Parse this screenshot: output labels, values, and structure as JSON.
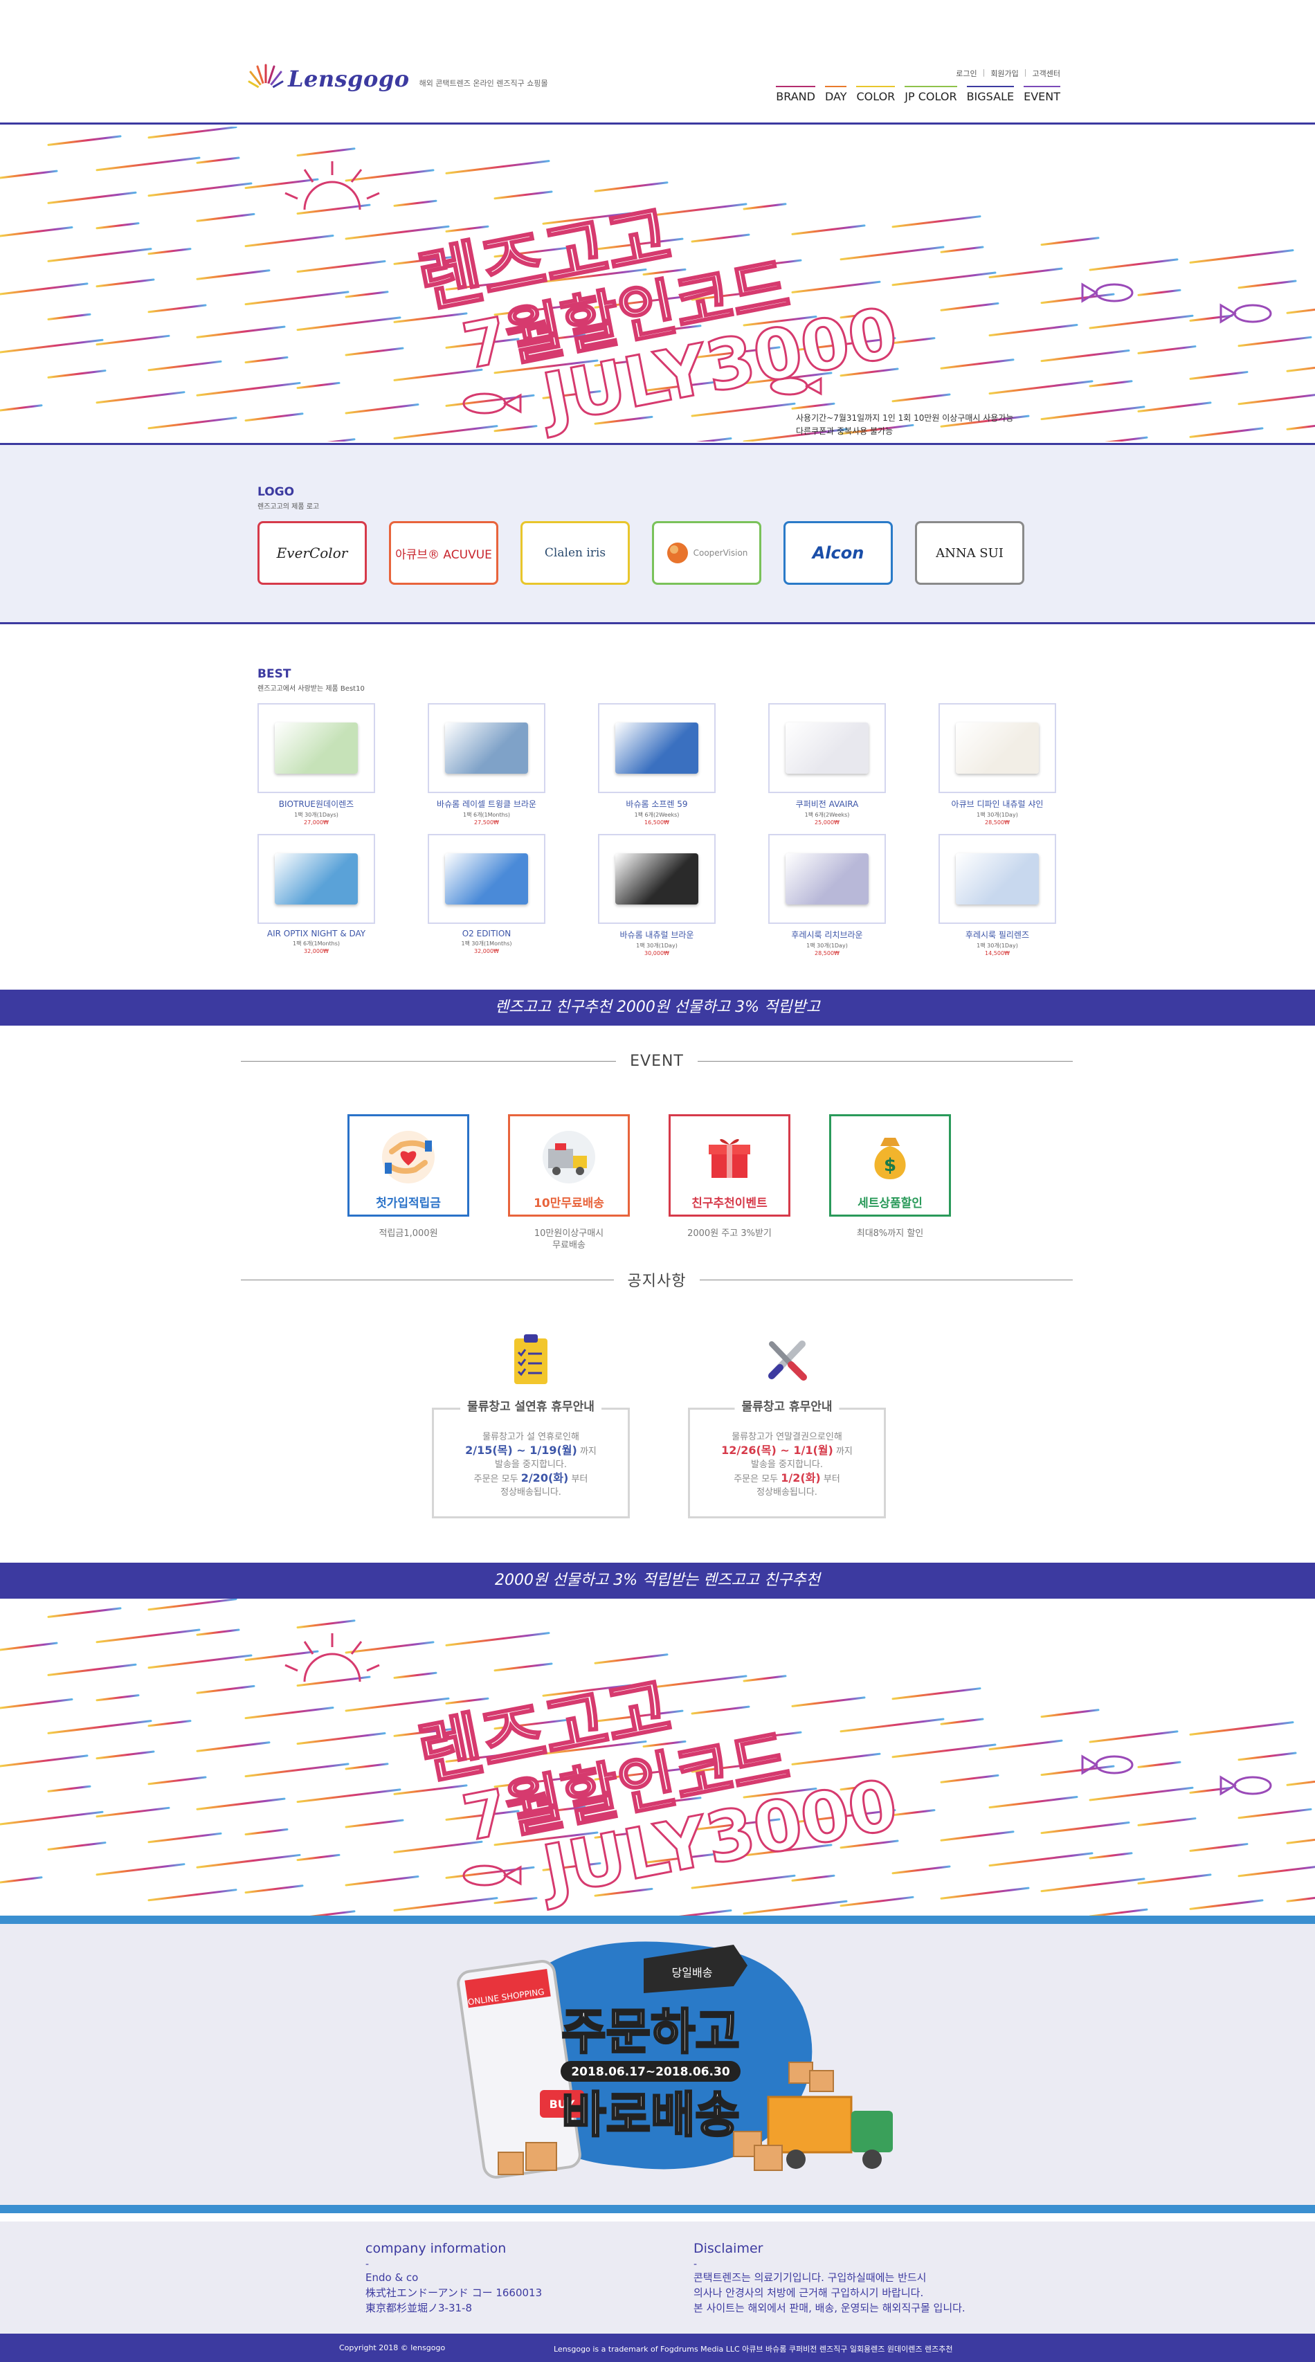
{
  "header": {
    "brand_name": "Lensgogo",
    "tagline": "해외 콘택트렌즈 온라인 렌즈직구 쇼핑몰",
    "util_links": [
      "로그인",
      "회원가입",
      "고객센터"
    ],
    "nav": [
      {
        "label": "BRAND",
        "color": "#b42c6e"
      },
      {
        "label": "DAY",
        "color": "#e87a2c"
      },
      {
        "label": "COLOR",
        "color": "#e8c62c"
      },
      {
        "label": "JP COLOR",
        "color": "#8fc24a"
      },
      {
        "label": "BIGSALE",
        "color": "#3c3aa0"
      },
      {
        "label": "EVENT",
        "color": "#7a4ab8"
      }
    ]
  },
  "banner": {
    "line1": "렌즈고고",
    "line2": "7월할인코드",
    "line3": "JULY3000",
    "note_line1": "사용기간~7월31일까지 1인 1회 10만원 이상구매시 사용가능",
    "note_line2": "다른쿠폰과 중복사용 불가능"
  },
  "logo_section": {
    "title": "LOGO",
    "subtitle": "렌즈고고의 제품 로고",
    "brands": [
      {
        "name": "EverColor",
        "color": "#d63a4a"
      },
      {
        "name": "아큐브® ACUVUE",
        "color": "#e8643c"
      },
      {
        "name": "Clalen iris",
        "color": "#e8c62c"
      },
      {
        "name": "CooperVision",
        "color": "#7ac25a"
      },
      {
        "name": "Alcon",
        "color": "#2a7ac8"
      },
      {
        "name": "ANNA SUI",
        "color": "#8a8a8a"
      }
    ]
  },
  "best": {
    "title": "BEST",
    "subtitle": "렌즈고고에서 사랑받는 제품 Best10",
    "products": [
      {
        "name": "BIOTRUE원데이렌즈",
        "desc": "1팩 30개(1Days)",
        "price": "27,000₩",
        "pack": "#c6e2b8"
      },
      {
        "name": "바슈롬 레이셀 트윙클 브라운",
        "desc": "1팩 6개(1Months)",
        "price": "27,500₩",
        "pack": "#7fa2c8"
      },
      {
        "name": "바슈롬 소프렌 59",
        "desc": "1팩 6개(2Weeks)",
        "price": "16,500₩",
        "pack": "#3a70c0"
      },
      {
        "name": "쿠퍼비전 AVAIRA",
        "desc": "1팩 6개(2Weeks)",
        "price": "25,000₩",
        "pack": "#e8e8ee"
      },
      {
        "name": "아큐브 디파인 내츄럴 샤인",
        "desc": "1팩 30개(1Day)",
        "price": "28,500₩",
        "pack": "#f2eee6"
      },
      {
        "name": "AIR OPTIX NIGHT & DAY",
        "desc": "1팩 6개(1Months)",
        "price": "32,000₩",
        "pack": "#5aa2d8"
      },
      {
        "name": "O2 EDITION",
        "desc": "1팩 30개(1Months)",
        "price": "32,000₩",
        "pack": "#4a8ad8"
      },
      {
        "name": "바슈롬 내츄럴 브라운",
        "desc": "1팩 30개(1Day)",
        "price": "30,000₩",
        "pack": "#2a2a2a"
      },
      {
        "name": "후레시룩 리치브라운",
        "desc": "1팩 30개(1Day)",
        "price": "28,500₩",
        "pack": "#b8b8d8"
      },
      {
        "name": "후레시룩 필리렌즈",
        "desc": "1팩 30개(1Day)",
        "price": "14,500₩",
        "pack": "#c8d8ee"
      }
    ]
  },
  "strip1": "렌즈고고 친구추천 2000원 선물하고 3% 적립받고",
  "event": {
    "title": "EVENT",
    "items": [
      {
        "label": "첫가입적립금",
        "sub": "적립금1,000원",
        "color": "#2a72c8",
        "icon": "heart-hands-icon"
      },
      {
        "label": "10만무료배송",
        "sub": "10만원이상구매시\n무료배송",
        "color": "#e8643c",
        "icon": "delivery-truck-icon"
      },
      {
        "label": "친구추천이벤트",
        "sub": "2000원 주고 3%받기",
        "color": "#d63a4a",
        "icon": "gift-box-icon"
      },
      {
        "label": "세트상품할인",
        "sub": "최대8%까지 할인",
        "color": "#2a9a5a",
        "icon": "money-bag-icon"
      }
    ]
  },
  "notice": {
    "title": "공지사항",
    "items": [
      {
        "title": "물류창고 설연휴 휴무안내",
        "line1": "물류창고가 설 연휴로인해",
        "date1": "2/15(목) ~ 1/19(월)",
        "line2": "까지",
        "line3": "발송을 중지합니다.",
        "line4": "주문은 모두",
        "date2": "2/20(화)",
        "line5": "부터",
        "line6": "정상배송됩니다.",
        "color": "#3c55a8"
      },
      {
        "title": "물류창고 휴무안내",
        "line1": "물류창고가 연말결권으로인해",
        "date1": "12/26(목) ~ 1/1(월)",
        "line2": "까지",
        "line3": "발송을 중지합니다.",
        "line4": "주문은 모두",
        "date2": "1/2(화)",
        "line5": "부터",
        "line6": "정상배송됩니다.",
        "color": "#d63a4a"
      }
    ]
  },
  "strip2": "2000원 선물하고 3% 적립받는 렌즈고고 친구추천",
  "delivery": {
    "badge": "당일배송",
    "title1": "주문하고",
    "dates": "2018.06.17~2018.06.30",
    "title2": "바로배송",
    "buy": "BUY",
    "app_label": "ONLINE SHOPPING"
  },
  "footer": {
    "company_title": "company information",
    "dash": "-",
    "company_lines": [
      "Endo & co",
      "株式社エンドーアンド コー 1660013",
      "東京都杉並堀ノ3-31-8"
    ],
    "disclaimer_title": "Disclaimer",
    "disclaimer_lines": [
      "콘택트렌즈는 의료기기입니다. 구입하실때에는 반드시",
      "의사나 안경사의 처방에 근거해 구입하시기 바랍니다.",
      "본 사이트는 해외에서 판매, 배송, 운영되는 해외직구몰 입니다."
    ],
    "copyright": "Copyright 2018 © lensgogo",
    "trademark": "Lensgogo is a trademark of Fogdrums Media LLC 아큐브 바슈롬 쿠퍼비전 렌즈직구 일회용렌즈 원데이렌즈 렌즈추천"
  }
}
